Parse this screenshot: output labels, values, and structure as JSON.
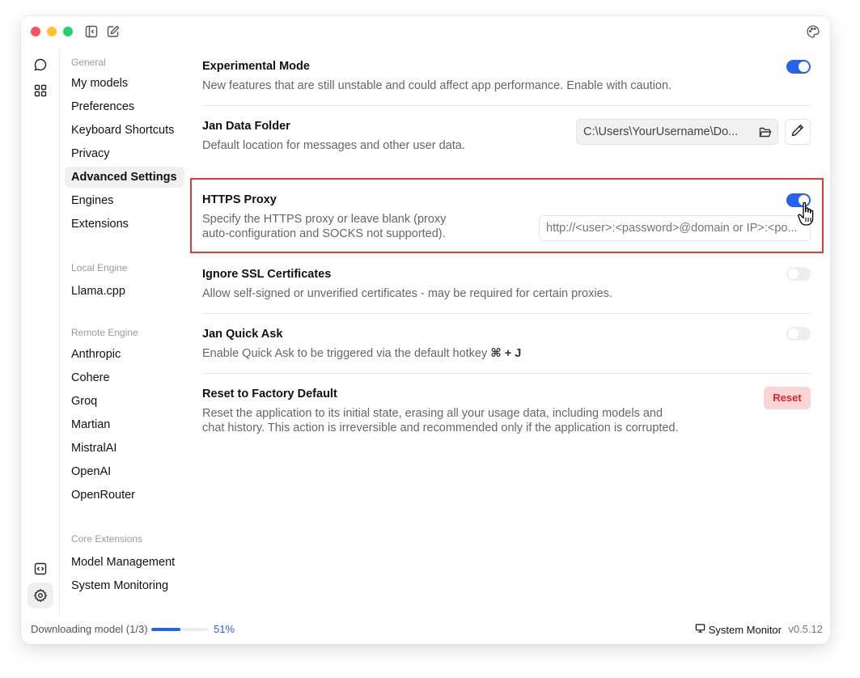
{
  "window": {
    "traffic_lights": {
      "close": "#fe4f5e",
      "minimize": "#fec22d",
      "maximize": "#1fd46c"
    },
    "toolbar_icons": [
      "sidebar-toggle-icon",
      "compose-icon",
      "palette-icon"
    ]
  },
  "rail": {
    "top_icons": [
      "chat-icon",
      "hub-grid-icon"
    ],
    "bottom_icons": [
      "code-icon",
      "settings-icon"
    ],
    "active": "settings-icon"
  },
  "nav": {
    "sections": [
      {
        "heading": "General",
        "items": [
          "My models",
          "Preferences",
          "Keyboard Shortcuts",
          "Privacy",
          "Advanced Settings",
          "Engines",
          "Extensions"
        ]
      },
      {
        "heading": "Local Engine",
        "items": [
          "Llama.cpp"
        ]
      },
      {
        "heading": "Remote Engine",
        "items": [
          "Anthropic",
          "Cohere",
          "Groq",
          "Martian",
          "MistralAI",
          "OpenAI",
          "OpenRouter"
        ]
      },
      {
        "heading": "Core Extensions",
        "items": [
          "Model Management",
          "System Monitoring"
        ]
      }
    ],
    "active_item": "Advanced Settings"
  },
  "settings": {
    "experimental": {
      "title": "Experimental Mode",
      "desc": "New features that are still unstable and could affect app performance. Enable with caution.",
      "enabled": true
    },
    "data_folder": {
      "title": "Jan Data Folder",
      "desc": "Default location for messages and other user data.",
      "value": "C:\\Users\\YourUsername\\Do..."
    },
    "proxy": {
      "title": "HTTPS Proxy",
      "desc_line1": "Specify the HTTPS proxy or leave blank (proxy",
      "desc_line2": "auto-configuration and SOCKS not supported).",
      "enabled": true,
      "placeholder": "http://<user>:<password>@domain or IP>:<po..."
    },
    "ssl": {
      "title": "Ignore SSL Certificates",
      "desc": "Allow self-signed or unverified certificates - may be required for certain proxies.",
      "enabled": false
    },
    "quick_ask": {
      "title": "Jan Quick Ask",
      "desc": "Enable Quick Ask to be triggered via the default hotkey ",
      "hotkey": "⌘ + J",
      "enabled": false
    },
    "reset": {
      "title": "Reset to Factory Default",
      "desc_line1": "Reset the application to its initial state, erasing all your usage data, including models and",
      "desc_line2": "chat history. This action is irreversible and recommended only if the application is corrupted.",
      "button": "Reset"
    }
  },
  "footer": {
    "download_label": "Downloading model (1/3)",
    "progress_percent": 51,
    "progress_label": "51%",
    "system_monitor": "System Monitor",
    "version": "v0.5.12"
  },
  "colors": {
    "accent": "#2563eb",
    "danger": "#dc2626",
    "danger_bg": "#fbd5d5",
    "highlight_box": "#e53935"
  }
}
